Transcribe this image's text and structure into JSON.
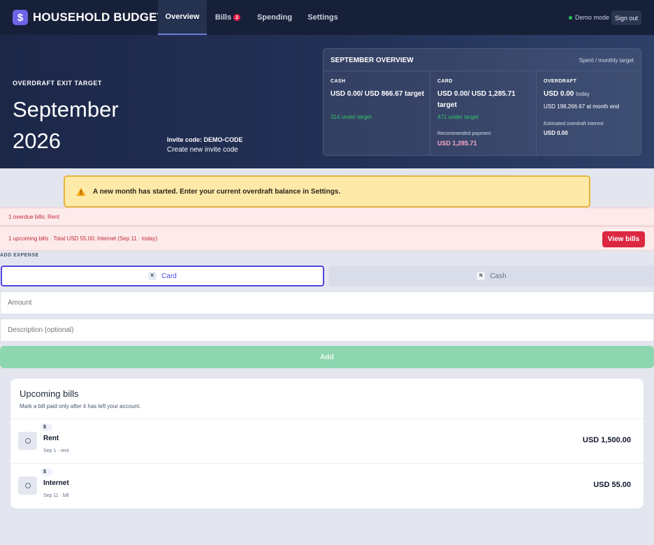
{
  "app": {
    "logo_glyph": "$",
    "title": "HOUSEHOLD BUDGET"
  },
  "nav": {
    "tabs": [
      {
        "label": "Overview",
        "active": true
      },
      {
        "label": "Bills",
        "badge": "2"
      },
      {
        "label": "Spending"
      },
      {
        "label": "Settings"
      }
    ],
    "demo_mode": "Demo mode",
    "sign_out": "Sign out"
  },
  "hero": {
    "kicker": "OVERDRAFT EXIT TARGET",
    "title": "September 2026",
    "invite_code": "Invite code: DEMO-CODE",
    "invite_link": "Create new invite code"
  },
  "overview": {
    "title": "SEPTEMBER OVERVIEW",
    "subtitle": "Spent / monthly target",
    "cash": {
      "label": "CASH",
      "value": "USD 0.00/ USD 866.67 target",
      "status": "314 under target"
    },
    "card": {
      "label": "CARD",
      "value": "USD 0.00/ USD 1,285.71 target",
      "status": "471 under target",
      "rec_label": "Recommended payment",
      "rec_value": "USD 1,285.71"
    },
    "overdraft": {
      "label": "OVERDRAFT",
      "today_value": "USD 0.00",
      "today_suffix": "today",
      "month_end": "USD 198,266.67 at month end",
      "interest_label": "Estimated overdraft interest",
      "interest_value": "USD 0.00"
    }
  },
  "alerts": {
    "warning": "A new month has started. Enter your current overdraft balance in Settings.",
    "overdue": "1 overdue bills: Rent",
    "upcoming": "1 upcoming bills · Total USD 55.00: Internet (Sep 11 · today)",
    "view_bills": "View bills"
  },
  "add_expense": {
    "label": "ADD EXPENSE",
    "card_key": "K",
    "card_label": "Card",
    "cash_key": "N",
    "cash_label": "Cash",
    "amount_placeholder": "Amount",
    "description_placeholder": "Description (optional)",
    "add_label": "Add"
  },
  "upcoming": {
    "title": "Upcoming bills",
    "subtitle": "Mark a bill paid only after it has left your account.",
    "bills": [
      {
        "tag": "$",
        "name": "Rent",
        "meta": "Sep 1 · rent",
        "amount": "USD 1,500.00"
      },
      {
        "tag": "$",
        "name": "Internet",
        "meta": "Sep 11 · bill",
        "amount": "USD 55.00"
      }
    ]
  },
  "colors": {
    "accent": "#4f46e5",
    "nav_bg": "#162038",
    "danger": "#dc2741",
    "success": "#22c55e",
    "warning_bg": "#fde9a8"
  }
}
